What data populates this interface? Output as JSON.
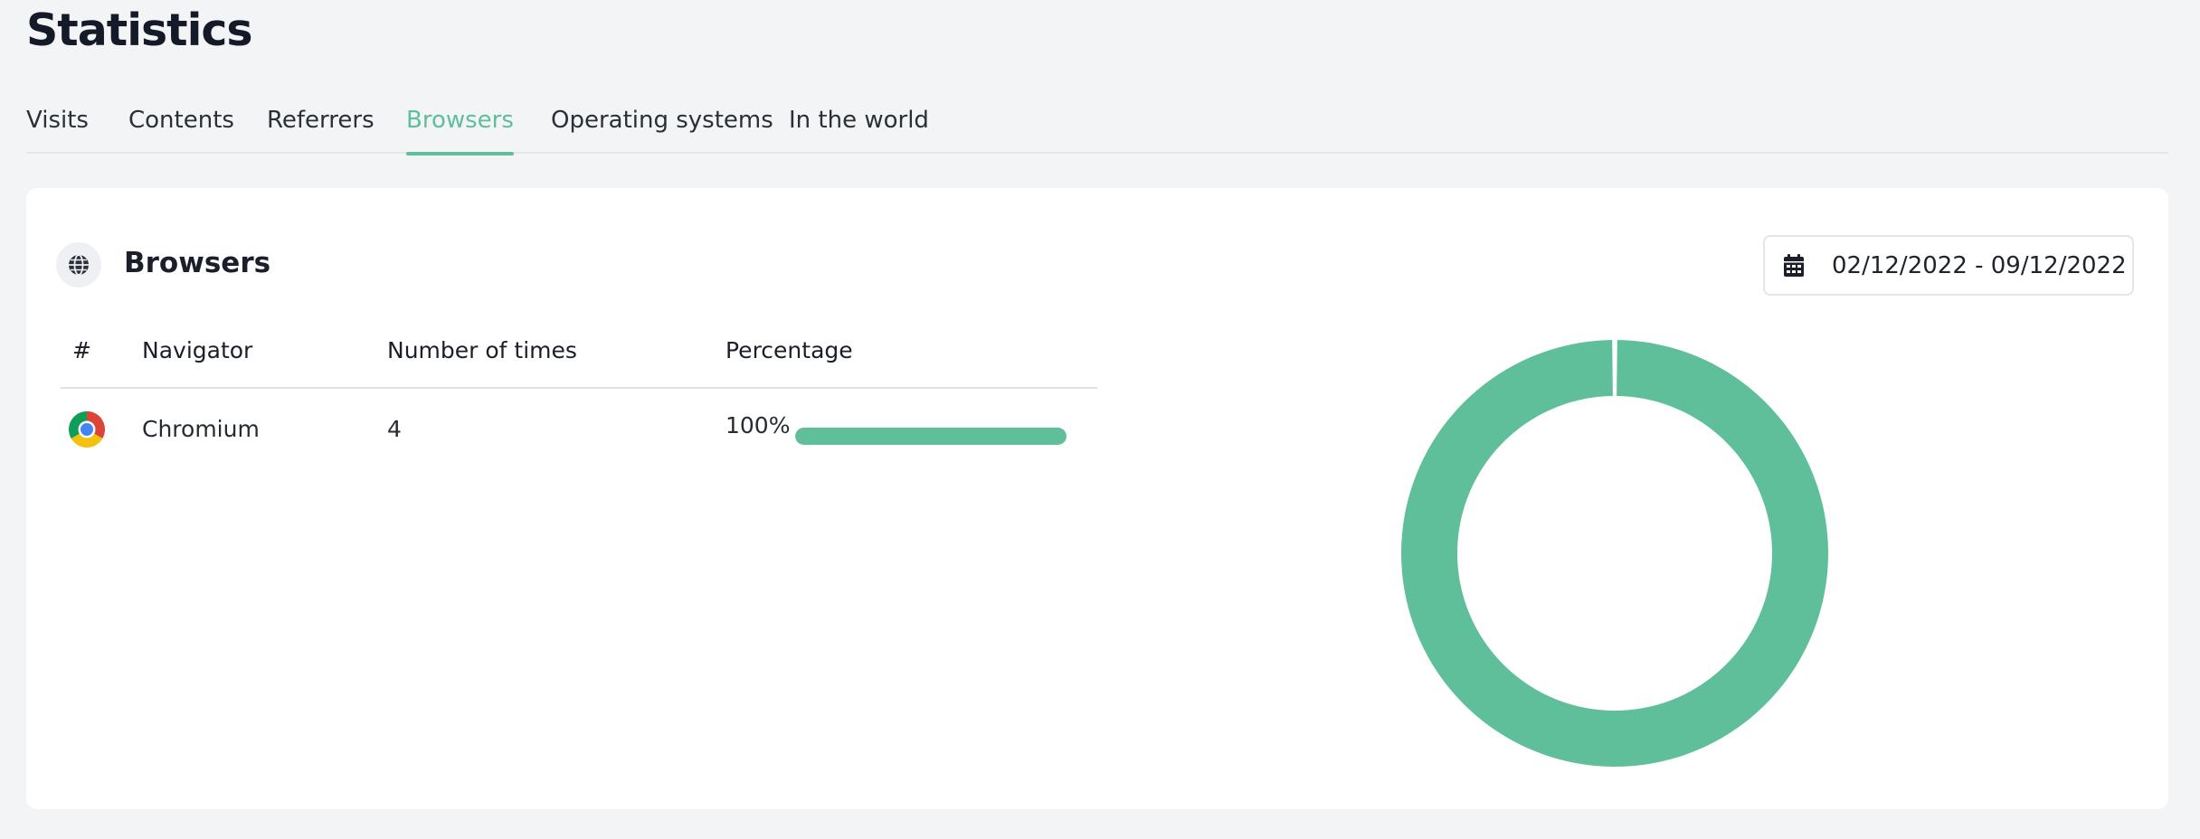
{
  "page": {
    "title": "Statistics"
  },
  "tabs": [
    {
      "label": "Visits",
      "active": false
    },
    {
      "label": "Contents",
      "active": false
    },
    {
      "label": "Referrers",
      "active": false
    },
    {
      "label": "Browsers",
      "active": true
    },
    {
      "label": "Operating systems",
      "active": false
    },
    {
      "label": "In the world",
      "active": false
    }
  ],
  "section": {
    "title": "Browsers",
    "icon": "globe-icon"
  },
  "date_range": {
    "value": "02/12/2022 - 09/12/2022",
    "icon": "calendar-icon"
  },
  "table": {
    "columns": [
      "#",
      "Navigator",
      "Number of times",
      "Percentage"
    ],
    "rows": [
      {
        "icon": "chromium-icon",
        "navigator": "Chromium",
        "count": "4",
        "percentage": "100%",
        "percentage_value": 100
      }
    ]
  },
  "colors": {
    "accent": "#5fbf9b",
    "title": "#141a28",
    "background": "#f3f4f6"
  },
  "chart_data": {
    "type": "pie",
    "variant": "donut",
    "categories": [
      "Chromium"
    ],
    "values": [
      4
    ],
    "colors": [
      "#5fbf9b"
    ]
  }
}
